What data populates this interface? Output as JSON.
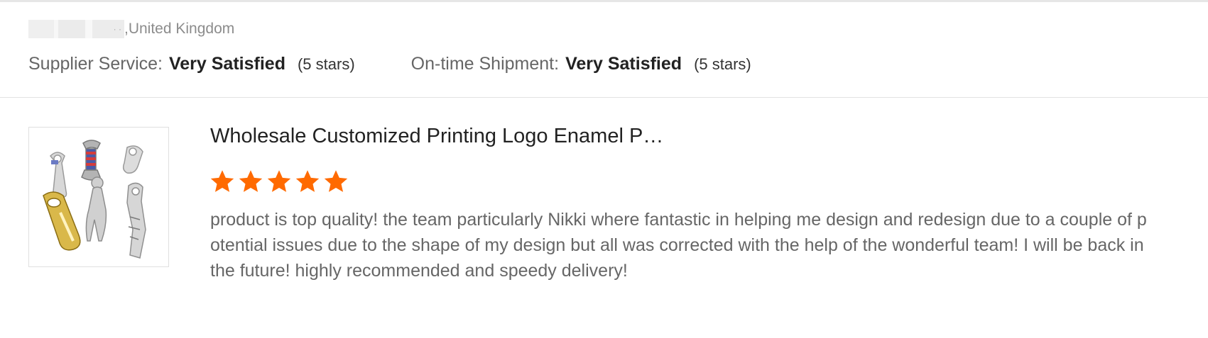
{
  "buyer": {
    "name_masked": "· ·",
    "location": ",United Kingdom"
  },
  "ratings": {
    "supplier_service": {
      "label": "Supplier Service:",
      "value": "Very Satisfied",
      "stars_text": "(5 stars)",
      "stars": 5
    },
    "on_time_shipment": {
      "label": "On-time Shipment:",
      "value": "Very Satisfied",
      "stars_text": "(5 stars)",
      "stars": 5
    }
  },
  "review": {
    "product_title": "Wholesale Customized Printing Logo Enamel P…",
    "product_image_icon": "product-bottle-openers-image",
    "rating_stars": 5,
    "star_color": "#ff6a00",
    "text": "product is top quality! the team particularly Nikki where fantastic in helping me design and redesign due to a couple of potential issues due to the shape of my design but all was corrected with the help of the wonderful team! I will be back in the future! highly recommended and speedy delivery!"
  }
}
